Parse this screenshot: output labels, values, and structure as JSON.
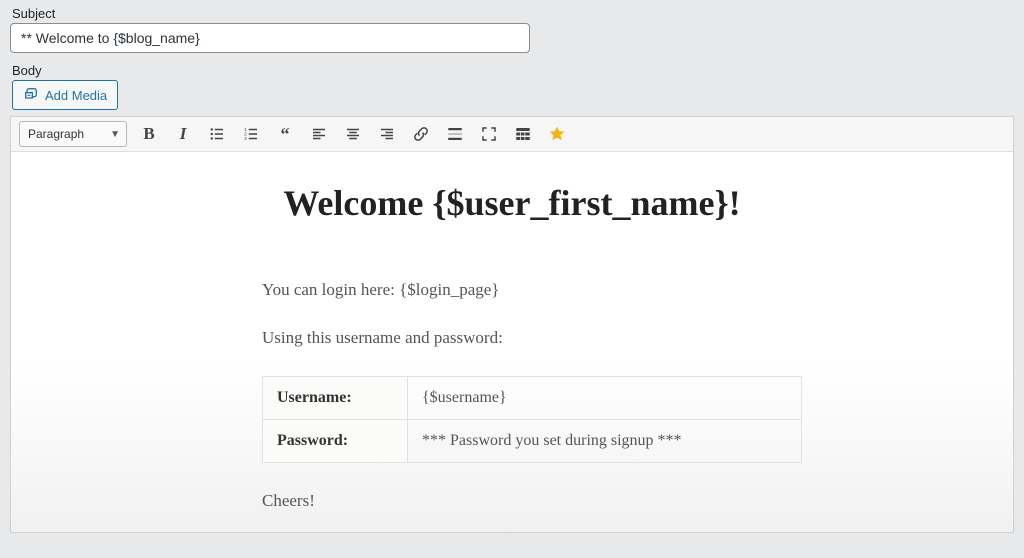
{
  "labels": {
    "subject": "Subject",
    "body": "Body"
  },
  "subject_value": "** Welcome to {$blog_name}",
  "add_media_label": "Add Media",
  "toolbar": {
    "format_selected": "Paragraph"
  },
  "content": {
    "heading": "Welcome {$user_first_name}!",
    "line1": "You can login here: {$login_page}",
    "line2": "Using this username and password:",
    "creds": {
      "username_label": "Username:",
      "username_value": "{$username}",
      "password_label": "Password:",
      "password_value": "*** Password you set during signup ***"
    },
    "signoff": "Cheers!"
  }
}
